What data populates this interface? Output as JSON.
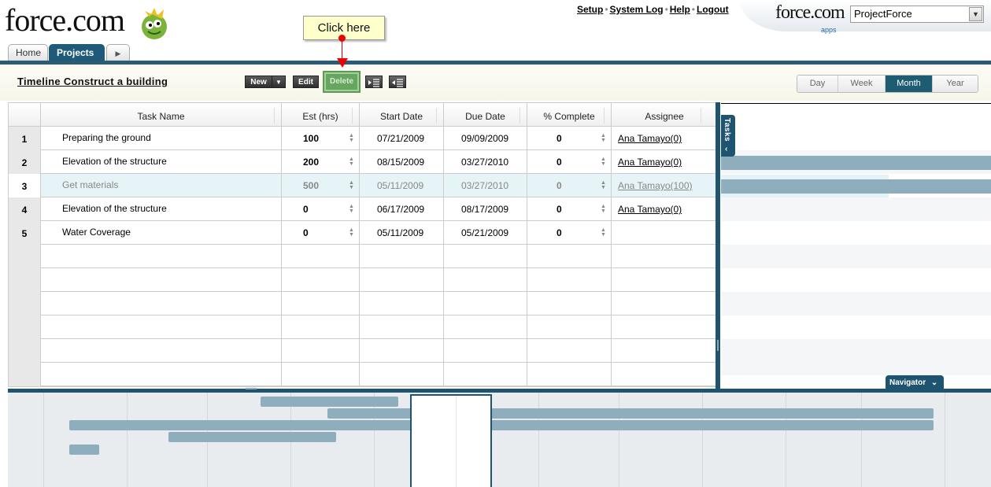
{
  "header": {
    "logo_text": "force.com",
    "links": [
      "Setup",
      "System Log",
      "Help",
      "Logout"
    ],
    "apps_logo": "force.com",
    "apps_label": "apps",
    "app_select_value": "ProjectForce"
  },
  "tabs": [
    "Home",
    "Projects"
  ],
  "callout": "Click here",
  "timeline_title": "Timeline Construct a building",
  "toolbar": {
    "new": "New",
    "edit": "Edit",
    "delete": "Delete"
  },
  "zoom": {
    "options": [
      "Day",
      "Week",
      "Month",
      "Year"
    ],
    "selected": "Month"
  },
  "grid": {
    "columns": [
      "Task Name",
      "Est (hrs)",
      "Start Date",
      "Due Date",
      "% Complete",
      "Assignee"
    ],
    "rows": [
      {
        "n": "1",
        "task": "Preparing the ground",
        "est": "100",
        "start": "07/21/2009",
        "due": "09/09/2009",
        "complete": "0",
        "assignee": "Ana Tamayo(0)"
      },
      {
        "n": "2",
        "task": "Elevation of the structure",
        "est": "200",
        "start": "08/15/2009",
        "due": "03/27/2010",
        "complete": "0",
        "assignee": "Ana Tamayo(0)"
      },
      {
        "n": "3",
        "task": "Get materials",
        "est": "500",
        "start": "05/11/2009",
        "due": "03/27/2010",
        "complete": "0",
        "assignee": "Ana Tamayo(100)"
      },
      {
        "n": "4",
        "task": "Elevation of the structure",
        "est": "0",
        "start": "06/17/2009",
        "due": "08/17/2009",
        "complete": "0",
        "assignee": "Ana Tamayo(0)"
      },
      {
        "n": "5",
        "task": "Water Coverage",
        "est": "0",
        "start": "05/11/2009",
        "due": "05/21/2009",
        "complete": "0",
        "assignee": ""
      }
    ],
    "selected_row": "3"
  },
  "gantt": {
    "tasks_tab": "Tasks",
    "navigator_label": "Navigator"
  },
  "colors": {
    "accent": "#1f5470",
    "bar": "#8eaebe",
    "selected_row": "#e6f4f8",
    "delete_button": "#67a560"
  }
}
